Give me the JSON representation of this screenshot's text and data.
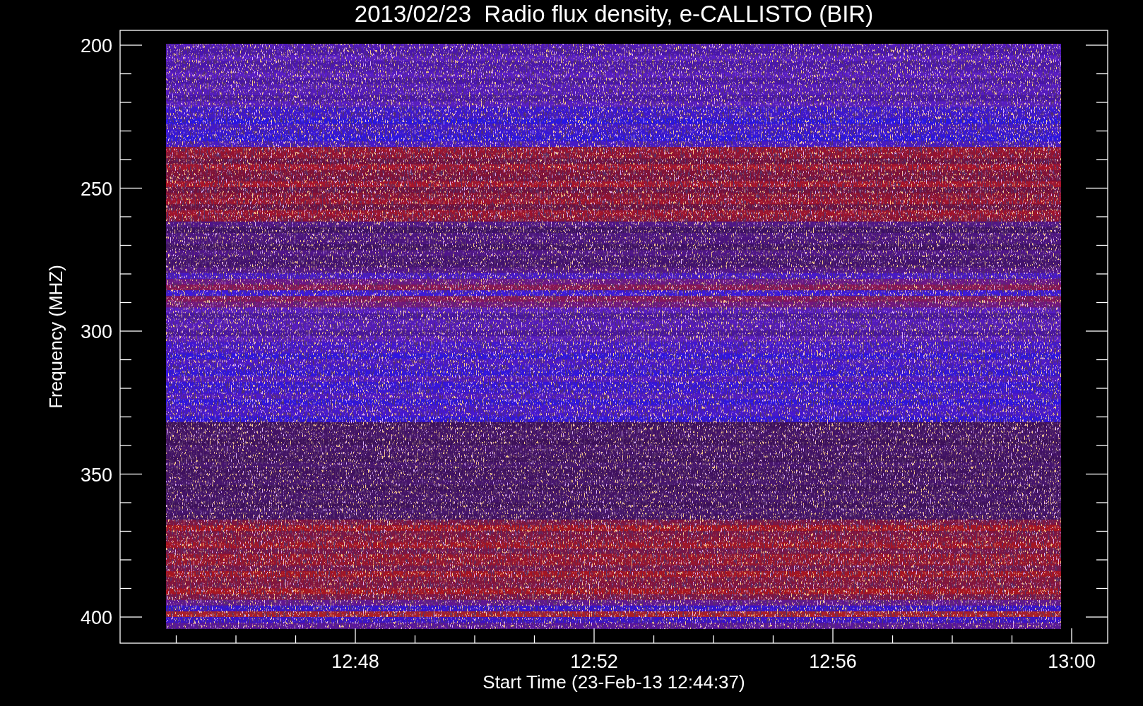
{
  "title": "2013/02/23  Radio flux density, e-CALLISTO (BIR)",
  "y_axis": {
    "label": "Frequency (MHZ)",
    "ticks": [
      "200",
      "250",
      "300",
      "350",
      "400"
    ]
  },
  "x_axis": {
    "label": "Start Time (23-Feb-13 12:44:37)",
    "ticks": [
      "12:48",
      "12:52",
      "12:56",
      "13:00"
    ]
  }
}
